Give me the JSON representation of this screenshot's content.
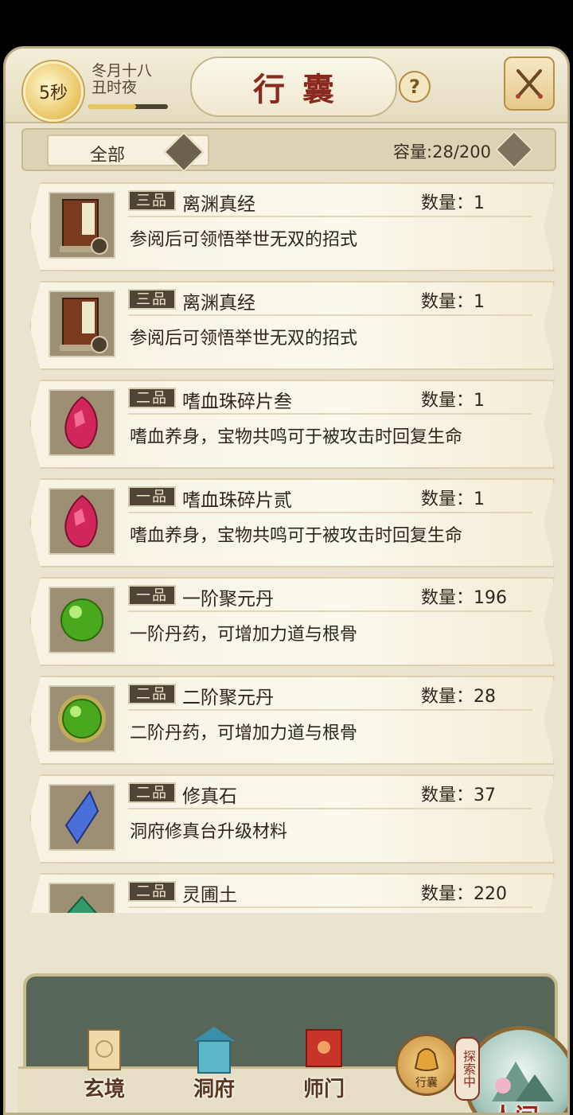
{
  "header": {
    "timer": "5秒",
    "date_line1": "冬月十八",
    "date_line2": "丑时夜",
    "title": "行囊"
  },
  "filter": {
    "selected": "全部",
    "capacity": "容量:28/200"
  },
  "items": [
    {
      "grade": "三品",
      "name": "离渊真经",
      "qty": "数量：1",
      "desc": "参阅后可领悟举世无双的招式",
      "icon": "scripture-book-icon"
    },
    {
      "grade": "三品",
      "name": "离渊真经",
      "qty": "数量：1",
      "desc": "参阅后可领悟举世无双的招式",
      "icon": "scripture-book-icon"
    },
    {
      "grade": "二品",
      "name": "嗜血珠碎片叁",
      "qty": "数量：1",
      "desc": "嗜血养身，宝物共鸣可于被攻击时回复生命",
      "icon": "blood-shard-icon"
    },
    {
      "grade": "一品",
      "name": "嗜血珠碎片贰",
      "qty": "数量：1",
      "desc": "嗜血养身，宝物共鸣可于被攻击时回复生命",
      "icon": "blood-shard-icon"
    },
    {
      "grade": "一品",
      "name": "一阶聚元丹",
      "qty": "数量：196",
      "desc": "一阶丹药，可增加力道与根骨",
      "icon": "green-pill-icon"
    },
    {
      "grade": "二品",
      "name": "二阶聚元丹",
      "qty": "数量：28",
      "desc": "二阶丹药，可增加力道与根骨",
      "icon": "green-pill-glow-icon"
    },
    {
      "grade": "二品",
      "name": "修真石",
      "qty": "数量：37",
      "desc": "洞府修真台升级材料",
      "icon": "blue-crystal-icon"
    },
    {
      "grade": "二品",
      "name": "灵圃土",
      "qty": "数量：220",
      "desc": "",
      "icon": "spirit-soil-icon"
    }
  ],
  "nav": {
    "xuanjing": "玄境",
    "dongfu": "洞府",
    "shimen": "师门",
    "bag": "行囊",
    "explore": "探索中",
    "renjian": "人间"
  }
}
